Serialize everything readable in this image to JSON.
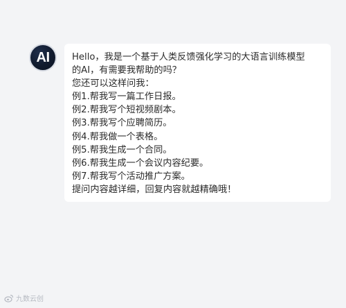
{
  "assistant": {
    "avatar_text": "AI"
  },
  "message": {
    "lines": [
      "Hello，我是一个基于人类反馈强化学习的大语言训练模型",
      "的AI，有需要我帮助的吗？",
      "您还可以这样问我：",
      "例1.帮我写一篇工作日报。",
      "例2.帮我写个短视频剧本。",
      "例3.帮我写个应聘简历。",
      "例4.帮我做一个表格。",
      "例5.帮我生成一个合同。",
      "例6.帮我生成一个会议内容纪要。",
      "例7.帮我写个活动推广方案。",
      "提问内容越详细，回复内容就越精确哦！"
    ]
  },
  "watermark": {
    "icon": "weibo-icon",
    "text": "九数云创"
  }
}
